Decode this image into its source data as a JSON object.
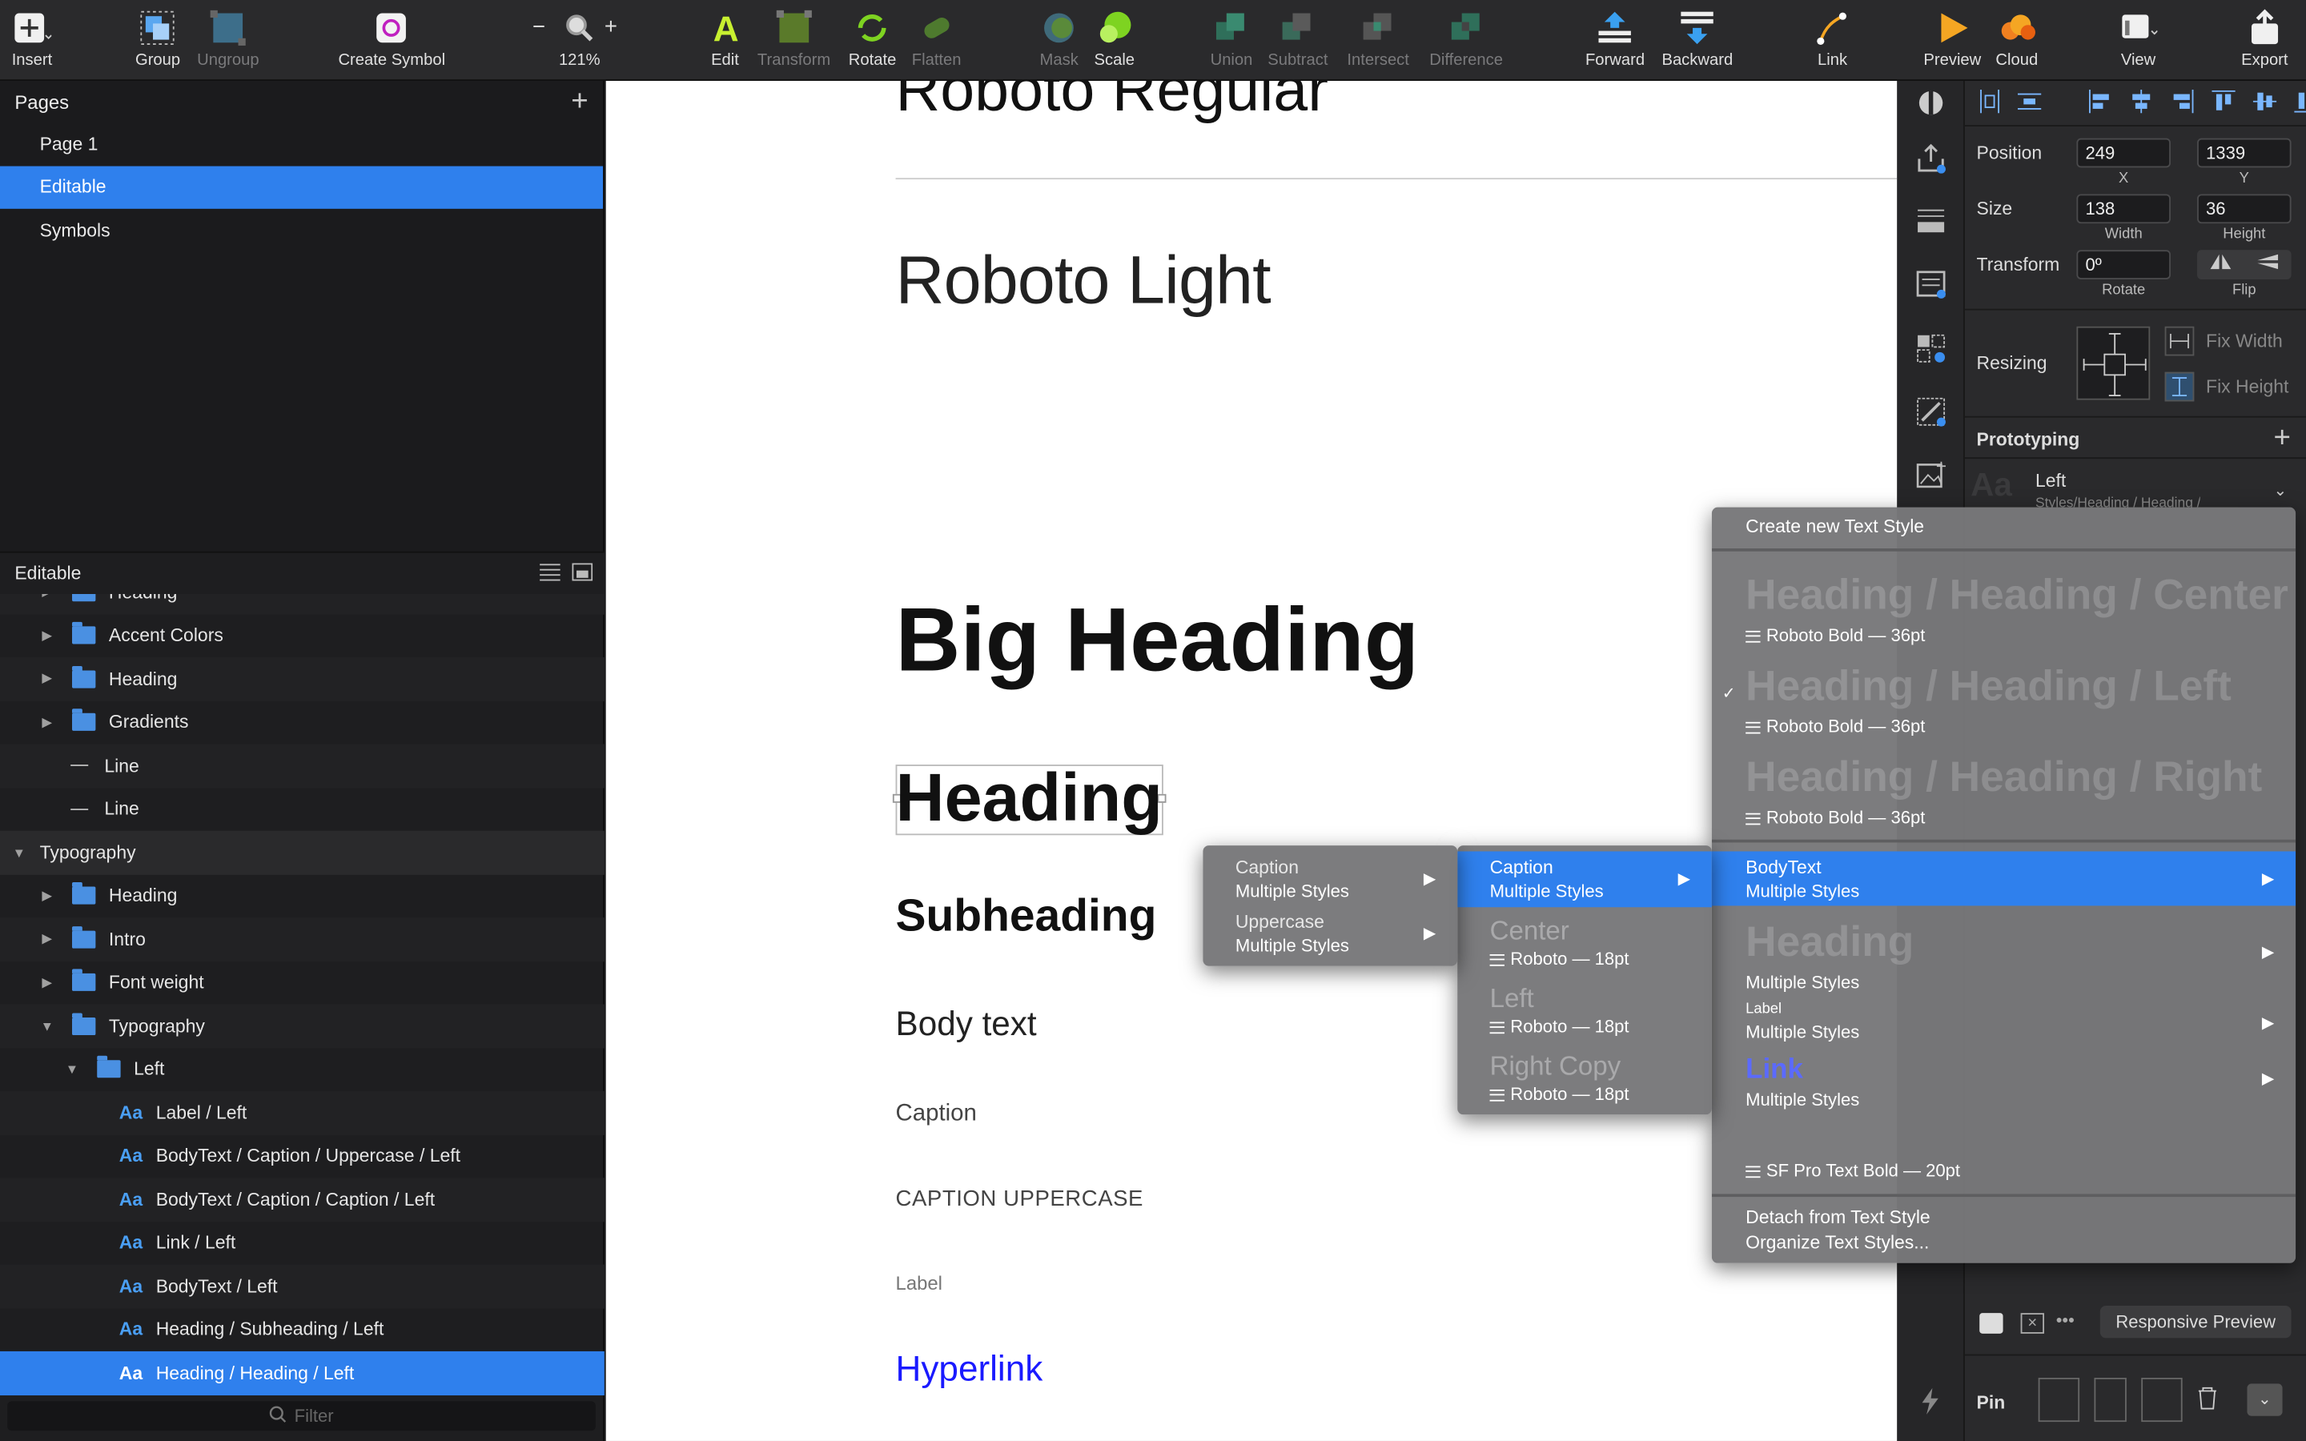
{
  "toolbar": {
    "insert": "Insert",
    "group": "Group",
    "ungroup": "Ungroup",
    "create_symbol": "Create Symbol",
    "zoom_minus": "−",
    "zoom_plus": "+",
    "zoom": "121%",
    "edit": "Edit",
    "transform": "Transform",
    "rotate": "Rotate",
    "flatten": "Flatten",
    "mask": "Mask",
    "scale": "Scale",
    "union": "Union",
    "subtract": "Subtract",
    "intersect": "Intersect",
    "difference": "Difference",
    "forward": "Forward",
    "backward": "Backward",
    "link": "Link",
    "preview": "Preview",
    "cloud": "Cloud",
    "view": "View",
    "export": "Export"
  },
  "pages": {
    "header": "Pages",
    "add": "+",
    "items": [
      "Page 1",
      "Editable",
      "Symbols"
    ]
  },
  "layers": {
    "header": "Editable",
    "rows": [
      {
        "label": "Heading",
        "kind": "folder"
      },
      {
        "label": "Accent Colors",
        "kind": "folder"
      },
      {
        "label": "Heading",
        "kind": "folder"
      },
      {
        "label": "Gradients",
        "kind": "folder"
      },
      {
        "label": "Line",
        "kind": "line"
      },
      {
        "label": "Line",
        "kind": "line"
      },
      {
        "label": "Typography",
        "kind": "group"
      },
      {
        "label": "Heading",
        "kind": "folder"
      },
      {
        "label": "Intro",
        "kind": "folder"
      },
      {
        "label": "Font weight",
        "kind": "folder"
      },
      {
        "label": "Typography",
        "kind": "folder-open"
      },
      {
        "label": "Left",
        "kind": "folder-open"
      },
      {
        "label": "Label / Left",
        "kind": "text"
      },
      {
        "label": "BodyText / Caption / Uppercase / Left",
        "kind": "text"
      },
      {
        "label": "BodyText / Caption / Caption / Left",
        "kind": "text"
      },
      {
        "label": "Link / Left",
        "kind": "text"
      },
      {
        "label": "BodyText / Left",
        "kind": "text"
      },
      {
        "label": "Heading / Subheading / Left",
        "kind": "text"
      },
      {
        "label": "Heading / Heading / Left",
        "kind": "text"
      }
    ],
    "aa": "Aa",
    "filter_placeholder": "Filter"
  },
  "canvas": {
    "roboto_regular": "Roboto Regular",
    "roboto_light": "Roboto Light",
    "big_heading": "Big Heading",
    "heading": "Heading",
    "subheading": "Subheading",
    "body_text": "Body text",
    "caption": "Caption",
    "caption_upper": "CAPTION UPPERCASE",
    "label": "Label",
    "hyperlink": "Hyperlink",
    "link_color": "#1a1aff"
  },
  "inspector": {
    "position": "Position",
    "x": "249",
    "y": "1339",
    "x_lbl": "X",
    "y_lbl": "Y",
    "size": "Size",
    "width": "138",
    "height": "36",
    "w_lbl": "Width",
    "h_lbl": "Height",
    "transform": "Transform",
    "rotate": "0º",
    "rotate_lbl": "Rotate",
    "flip_lbl": "Flip",
    "resizing": "Resizing",
    "fix_width": "Fix Width",
    "fix_height": "Fix Height",
    "prototyping": "Prototyping",
    "style_name": "Left",
    "style_path": "Styles/Heading / Heading /",
    "responsive_preview": "Responsive Preview",
    "pin": "Pin",
    "dots": "•••"
  },
  "menu_main": {
    "create": "Create new Text Style",
    "items": [
      {
        "big": "Heading / Heading / Center",
        "sub": "Roboto Bold — 36pt",
        "checked": false
      },
      {
        "big": "Heading / Heading / Left",
        "sub": "Roboto Bold — 36pt",
        "checked": true
      },
      {
        "big": "Heading / Heading / Right",
        "sub": "Roboto Bold — 36pt",
        "checked": false
      }
    ],
    "check": "✓",
    "bodytext": "BodyText",
    "bodytext_sub": "Multiple Styles",
    "heading_big": "Heading",
    "heading_sub": "Multiple Styles",
    "label_small": "Label",
    "label_sub": "Multiple Styles",
    "link_big": "Link",
    "link_sub": "Multiple Styles",
    "sf": "SF Pro Text Bold — 20pt",
    "detach": "Detach from Text Style",
    "organize": "Organize Text Styles..."
  },
  "menu_body": {
    "caption": "Caption",
    "caption_sub": "Multiple Styles",
    "uppercase": "Uppercase",
    "uppercase_sub": "Multiple Styles"
  },
  "menu_caption": {
    "caption": "Caption",
    "caption_sub": "Multiple Styles",
    "items": [
      {
        "big": "Center",
        "sub": "Roboto — 18pt"
      },
      {
        "big": "Left",
        "sub": "Roboto — 18pt"
      },
      {
        "big": "Right Copy",
        "sub": "Roboto — 18pt"
      }
    ]
  },
  "arrow": "▶"
}
